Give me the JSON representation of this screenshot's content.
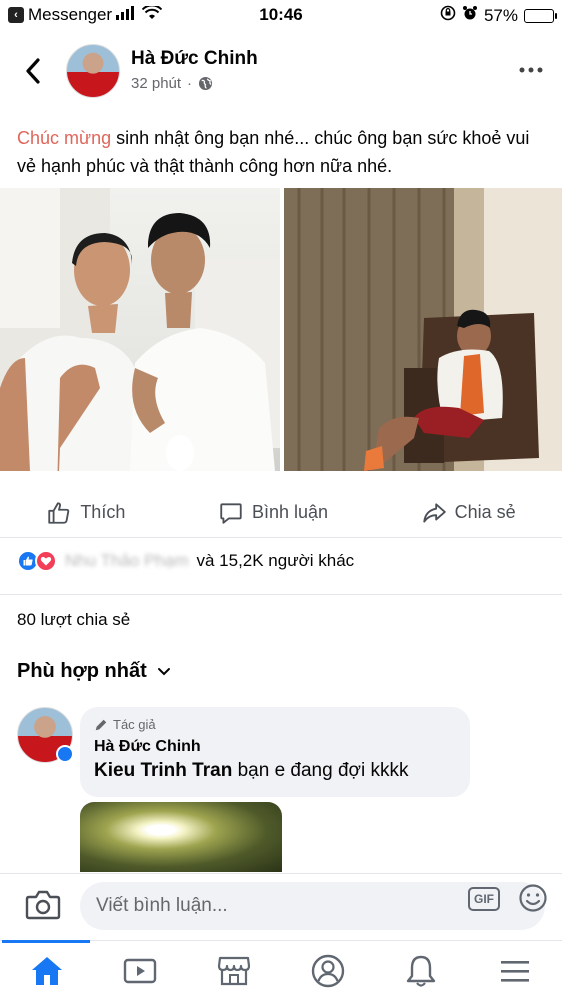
{
  "status_bar": {
    "carrier": "Messenger",
    "time": "10:46",
    "battery": "57%",
    "battery_level": 0.57
  },
  "post": {
    "author": "Hà Đức Chinh",
    "time": "32 phút",
    "text_highlight": "Chúc mừng",
    "text_rest": " sinh nhật ông bạn nhé... chúc ông bạn sức khoẻ vui vẻ hạnh phúc và thật thành công hơn nữa nhé."
  },
  "actions": {
    "like": "Thích",
    "comment": "Bình luận",
    "share": "Chia sẻ"
  },
  "reactions": {
    "blurred_name": "Nhu Thảo Phạm",
    "summary": "và 15,2K người khác"
  },
  "shares": "80 lượt chia sẻ",
  "sort_label": "Phù hợp nhất",
  "comment": {
    "badge": "Tác giả",
    "author": "Hà Đức Chinh",
    "mention": "Kieu Trinh Tran",
    "text": " bạn e đang đợi kkkk"
  },
  "input": {
    "placeholder": "Viết bình luận...",
    "gif_label": "GIF"
  },
  "colors": {
    "accent": "#1877f2",
    "highlight": "#e0665a",
    "love": "#f33e58"
  },
  "icons": [
    "back-icon",
    "globe-icon",
    "more-icon",
    "like-icon",
    "comment-icon",
    "share-icon",
    "camera-icon",
    "gif-icon",
    "emoji-icon",
    "home-icon",
    "watch-icon",
    "marketplace-icon",
    "profile-icon",
    "notifications-icon",
    "menu-icon"
  ]
}
